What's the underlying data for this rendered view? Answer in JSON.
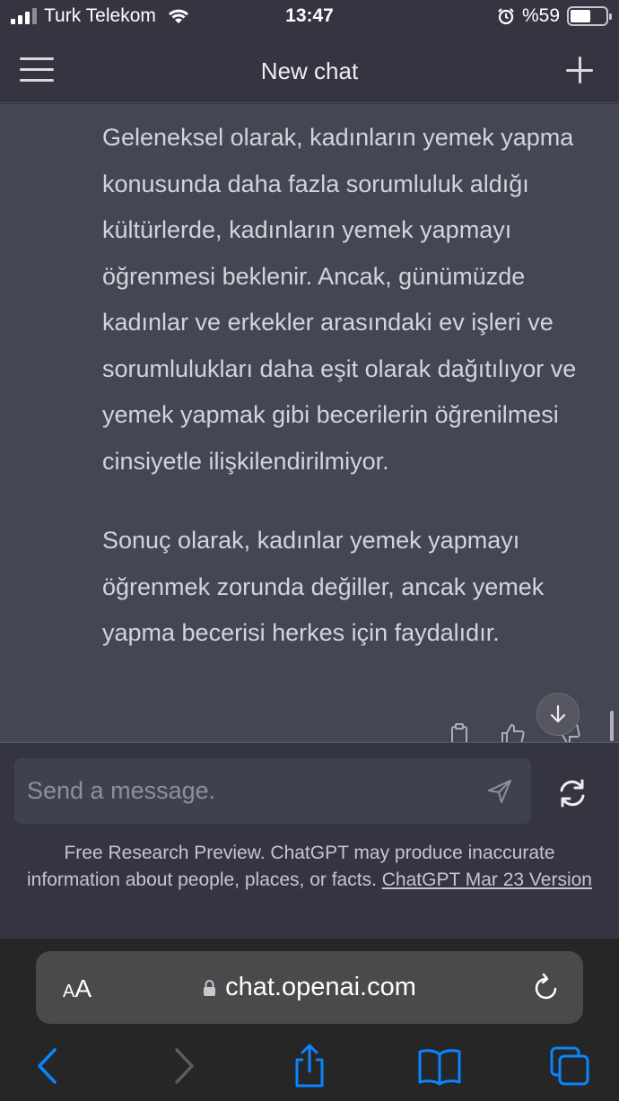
{
  "status_bar": {
    "carrier": "Turk Telekom",
    "time": "13:47",
    "battery": "%59",
    "battery_level": 0.59,
    "icons": [
      "signal-icon",
      "wifi-icon",
      "alarm-icon",
      "battery-icon"
    ]
  },
  "header": {
    "title": "New chat",
    "menu_icon": "hamburger-menu-icon",
    "new_chat_icon": "plus-icon"
  },
  "message": {
    "paragraphs": [
      "Geleneksel olarak, kadınların yemek yapma konusunda daha fazla sorumluluk aldığı kültürlerde, kadınların yemek yapmayı öğrenmesi beklenir. Ancak, günümüzde kadınlar ve erkekler arasındaki ev işleri ve sorumlulukları daha eşit olarak dağıtılıyor ve yemek yapmak gibi becerilerin öğrenilmesi cinsiyetle ilişkilendirilmiyor.",
      "Sonuç olarak, kadınlar yemek yapmayı öğrenmek zorunda değiller, ancak yemek yapma becerisi herkes için faydalıdır."
    ],
    "action_icons": [
      "copy-icon",
      "thumbs-up-icon",
      "thumbs-down-icon"
    ]
  },
  "composer": {
    "placeholder": "Send a message.",
    "send_icon": "send-icon",
    "regenerate_icon": "regenerate-icon"
  },
  "disclaimer": {
    "text": "Free Research Preview. ChatGPT may produce inaccurate information about people, places, or facts. ",
    "link": "ChatGPT Mar 23 Version"
  },
  "browser": {
    "aa_small": "A",
    "aa_big": "A",
    "url": "chat.openai.com",
    "toolbar": [
      "back-icon",
      "forward-icon",
      "share-icon",
      "bookmarks-icon",
      "tabs-icon"
    ]
  },
  "colors": {
    "background": "#343541",
    "message_bg": "#444654",
    "input_bg": "#40414f",
    "safari_accent": "#0a84ff"
  }
}
